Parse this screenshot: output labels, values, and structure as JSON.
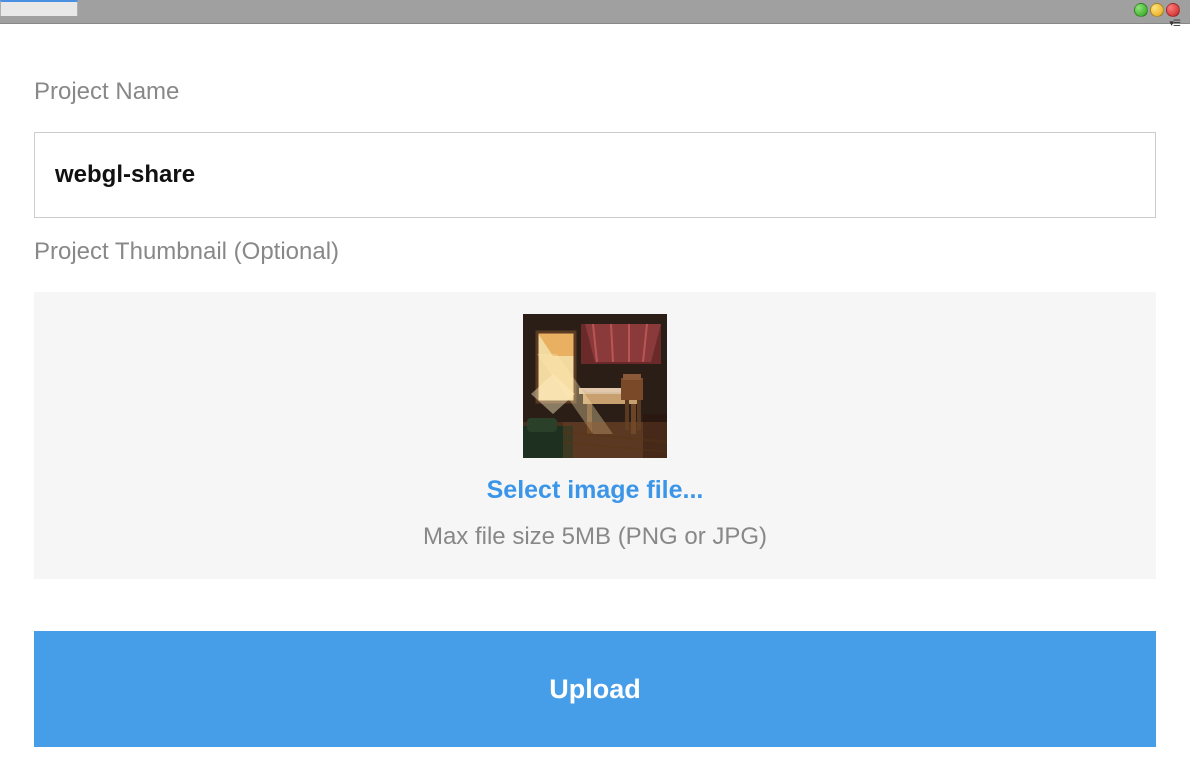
{
  "labels": {
    "projectName": "Project Name",
    "projectThumbnail": "Project Thumbnail (Optional)"
  },
  "inputs": {
    "projectNameValue": "webgl-share"
  },
  "thumbnail": {
    "selectLabel": "Select image file...",
    "hint": "Max file size 5MB (PNG or JPG)"
  },
  "buttons": {
    "upload": "Upload"
  }
}
